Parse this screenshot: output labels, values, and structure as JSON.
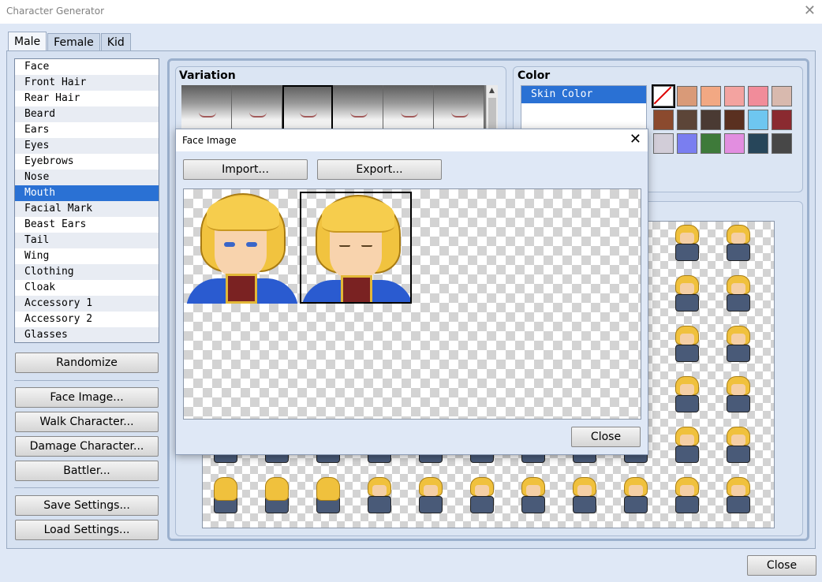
{
  "window": {
    "title": "Character Generator"
  },
  "tabs": [
    "Male",
    "Female",
    "Kid"
  ],
  "active_tab": "Male",
  "parts": [
    "Face",
    "Front Hair",
    "Rear Hair",
    "Beard",
    "Ears",
    "Eyes",
    "Eyebrows",
    "Nose",
    "Mouth",
    "Facial Mark",
    "Beast Ears",
    "Tail",
    "Wing",
    "Clothing",
    "Cloak",
    "Accessory 1",
    "Accessory 2",
    "Glasses"
  ],
  "selected_part": "Mouth",
  "buttons": {
    "randomize": "Randomize",
    "face_image": "Face Image...",
    "walk_character": "Walk Character...",
    "damage_character": "Damage Character...",
    "battler": "Battler...",
    "save_settings": "Save Settings...",
    "load_settings": "Load Settings...",
    "close": "Close"
  },
  "variation": {
    "label": "Variation",
    "selected_index": 2,
    "count": 6
  },
  "color": {
    "label": "Color",
    "items": [
      "Skin Color"
    ],
    "swatches": [
      "none",
      "#d99a78",
      "#f2a883",
      "#f3a3a0",
      "#f18c9a",
      "#d8b9ae",
      "#8b4a2e",
      "#5c4538",
      "#4a3a33",
      "#5a3020",
      "#6ec6f0",
      "#8a2a30",
      "#d2cdd8",
      "#7a7ef0",
      "#3e7a3a",
      "#e28ee0",
      "#27465a",
      "#474747"
    ]
  },
  "dialog": {
    "title": "Face Image",
    "import_label": "Import...",
    "export_label": "Export...",
    "close_label": "Close",
    "faces": [
      {
        "expression": "open-eyes",
        "selected": false
      },
      {
        "expression": "closed-eyes",
        "selected": true
      }
    ]
  }
}
